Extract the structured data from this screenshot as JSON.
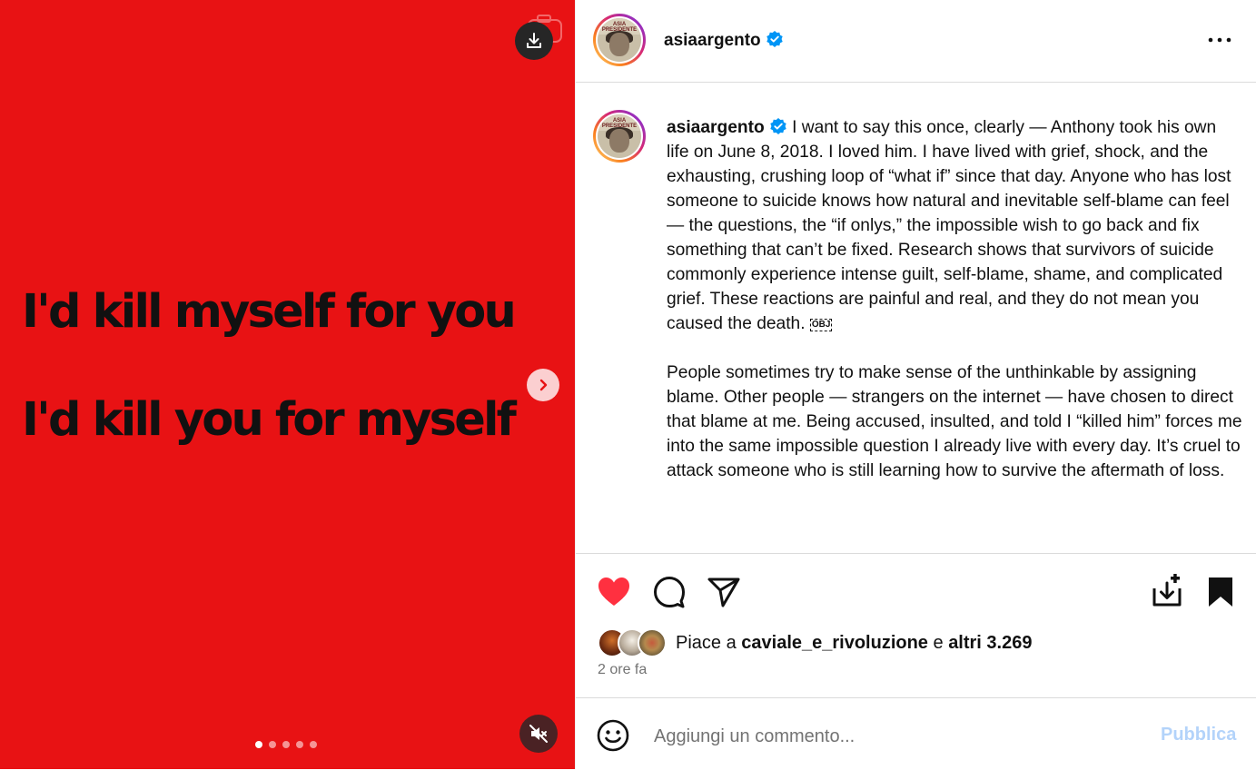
{
  "media": {
    "lines": [
      "I'd kill myself for you",
      "I'd kill you for myself"
    ],
    "background_color": "#e81214",
    "carousel": {
      "total": 5,
      "active_index": 0
    }
  },
  "post": {
    "username": "asiaargento",
    "verified": true,
    "avatar_text": "ASIA PRESIDENTE",
    "caption_paragraphs": [
      "I want to say this once, clearly — Anthony took his own life on June 8, 2018. I loved him. I have lived with grief, shock, and the exhausting, crushing loop of “what if” since that day. Anyone who has lost someone to suicide knows how natural and inevitable self-blame can feel — the questions, the “if onlys,” the impossible wish to go back and fix something that can’t be fixed. Research shows that survivors of suicide commonly experience intense guilt, self-blame, shame, and complicated grief. These reactions are painful and real, and they do not mean you caused the death.",
      "People sometimes try to make sense of the unthinkable by assigning blame. Other people — strangers on the internet — have chosen to direct that blame at me. Being accused, insulted, and told I “killed him” forces me into the same impossible question I already live with every day. It’s cruel to attack someone who is still learning how to survive the aftermath of loss."
    ],
    "obj_glyph": "OBJ"
  },
  "likes": {
    "prefix": "Piace a ",
    "user": "caviale_e_rivoluzione",
    "middle": " e ",
    "others": "altri 3.269"
  },
  "time_ago": "2 ore fa",
  "comment": {
    "placeholder": "Aggiungi un commento...",
    "publish_label": "Pubblica"
  },
  "colors": {
    "like_red": "#ff3040",
    "verified_blue": "#0095f6",
    "publish_disabled": "#b3d3fa"
  }
}
